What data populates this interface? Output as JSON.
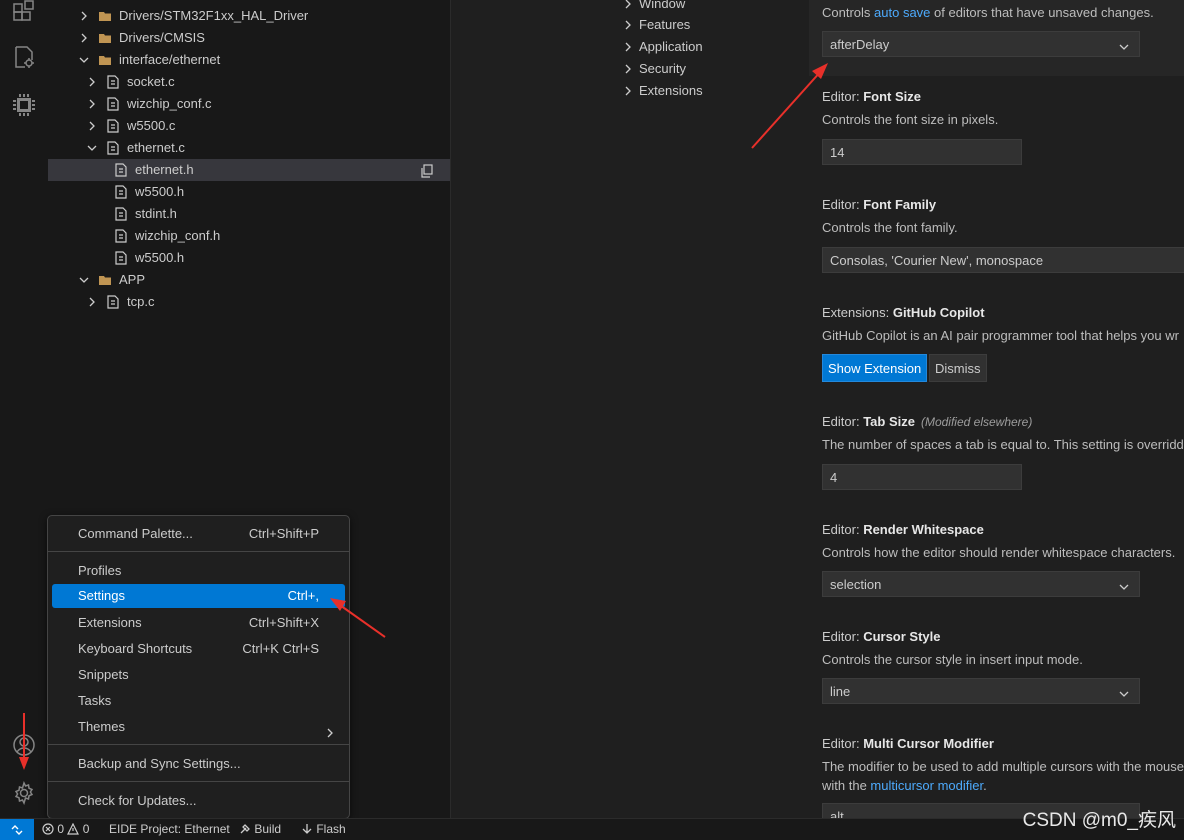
{
  "explorer": {
    "items": [
      {
        "label": "Drivers/STM32F1xx_HAL_Driver",
        "type": "folder",
        "state": "collapsed"
      },
      {
        "label": "Drivers/CMSIS",
        "type": "folder",
        "state": "collapsed"
      },
      {
        "label": "interface/ethernet",
        "type": "folder",
        "state": "expanded"
      },
      {
        "label": "socket.c",
        "type": "file",
        "state": "collapsed"
      },
      {
        "label": "wizchip_conf.c",
        "type": "file",
        "state": "collapsed"
      },
      {
        "label": "w5500.c",
        "type": "file",
        "state": "collapsed"
      },
      {
        "label": "ethernet.c",
        "type": "file",
        "state": "expanded"
      },
      {
        "label": "ethernet.h",
        "type": "file",
        "state": "none"
      },
      {
        "label": "w5500.h",
        "type": "file",
        "state": "none"
      },
      {
        "label": "stdint.h",
        "type": "file",
        "state": "none"
      },
      {
        "label": "wizchip_conf.h",
        "type": "file",
        "state": "none"
      },
      {
        "label": "w5500.h",
        "type": "file",
        "state": "none"
      },
      {
        "label": "APP",
        "type": "folder",
        "state": "expanded"
      },
      {
        "label": "tcp.c",
        "type": "file",
        "state": "collapsed"
      }
    ]
  },
  "toc": {
    "items": [
      "Window",
      "Features",
      "Application",
      "Security",
      "Extensions"
    ]
  },
  "settings": {
    "autosave": {
      "desc_pre": "Controls ",
      "desc_link": "auto save",
      "desc_post": " of editors that have unsaved changes.",
      "value": "afterDelay"
    },
    "font_size": {
      "category": "Editor: ",
      "name": "Font Size",
      "desc": "Controls the font size in pixels.",
      "value": "14"
    },
    "font_family": {
      "category": "Editor: ",
      "name": "Font Family",
      "desc": "Controls the font family.",
      "value": "Consolas, 'Courier New', monospace"
    },
    "copilot": {
      "category": "Extensions: ",
      "name": "GitHub Copilot",
      "desc": "GitHub Copilot is an AI pair programmer tool that helps you wr",
      "show_label": "Show Extension",
      "dismiss_label": "Dismiss"
    },
    "tab_size": {
      "category": "Editor: ",
      "name": "Tab Size",
      "modified": "(Modified elsewhere)",
      "desc": "The number of spaces a tab is equal to. This setting is overridde",
      "value": "4"
    },
    "whitespace": {
      "category": "Editor: ",
      "name": "Render Whitespace",
      "desc": "Controls how the editor should render whitespace characters.",
      "value": "selection"
    },
    "cursor_style": {
      "category": "Editor: ",
      "name": "Cursor Style",
      "desc": "Controls the cursor style in insert input mode.",
      "value": "line"
    },
    "multicursor": {
      "category": "Editor: ",
      "name": "Multi Cursor Modifier",
      "desc1": "The modifier to be used to add multiple cursors with the mouse",
      "desc2_pre": "with the ",
      "desc2_link": "multicursor modifier",
      "desc2_post": ".",
      "value": "alt"
    }
  },
  "menu": {
    "items": [
      {
        "label": "Command Palette...",
        "key": "Ctrl+Shift+P"
      },
      {
        "label": "Profiles",
        "key": ""
      },
      {
        "label": "Settings",
        "key": "Ctrl+,"
      },
      {
        "label": "Extensions",
        "key": "Ctrl+Shift+X"
      },
      {
        "label": "Keyboard Shortcuts",
        "key": "Ctrl+K Ctrl+S"
      },
      {
        "label": "Snippets",
        "key": ""
      },
      {
        "label": "Tasks",
        "key": ""
      },
      {
        "label": "Themes",
        "key": ""
      },
      {
        "label": "Backup and Sync Settings...",
        "key": ""
      },
      {
        "label": "Check for Updates...",
        "key": ""
      }
    ]
  },
  "status": {
    "errors": "0",
    "warnings": "0",
    "project": "EIDE Project: Ethernet",
    "build": "Build",
    "flash": "Flash"
  },
  "watermark": "CSDN @m0_疾风",
  "colors": {
    "accent": "#0078d4",
    "arrow": "#e8302a",
    "link": "#4daafc"
  },
  "icons": [
    "extensions-icon",
    "eide-icon",
    "chip-icon",
    "account-icon",
    "manage-gear-icon",
    "folder-icon",
    "file-icon",
    "chevron-right-icon",
    "chevron-down-icon",
    "copy-icon",
    "remote-icon",
    "error-icon",
    "warning-icon",
    "build-icon",
    "flash-icon"
  ]
}
